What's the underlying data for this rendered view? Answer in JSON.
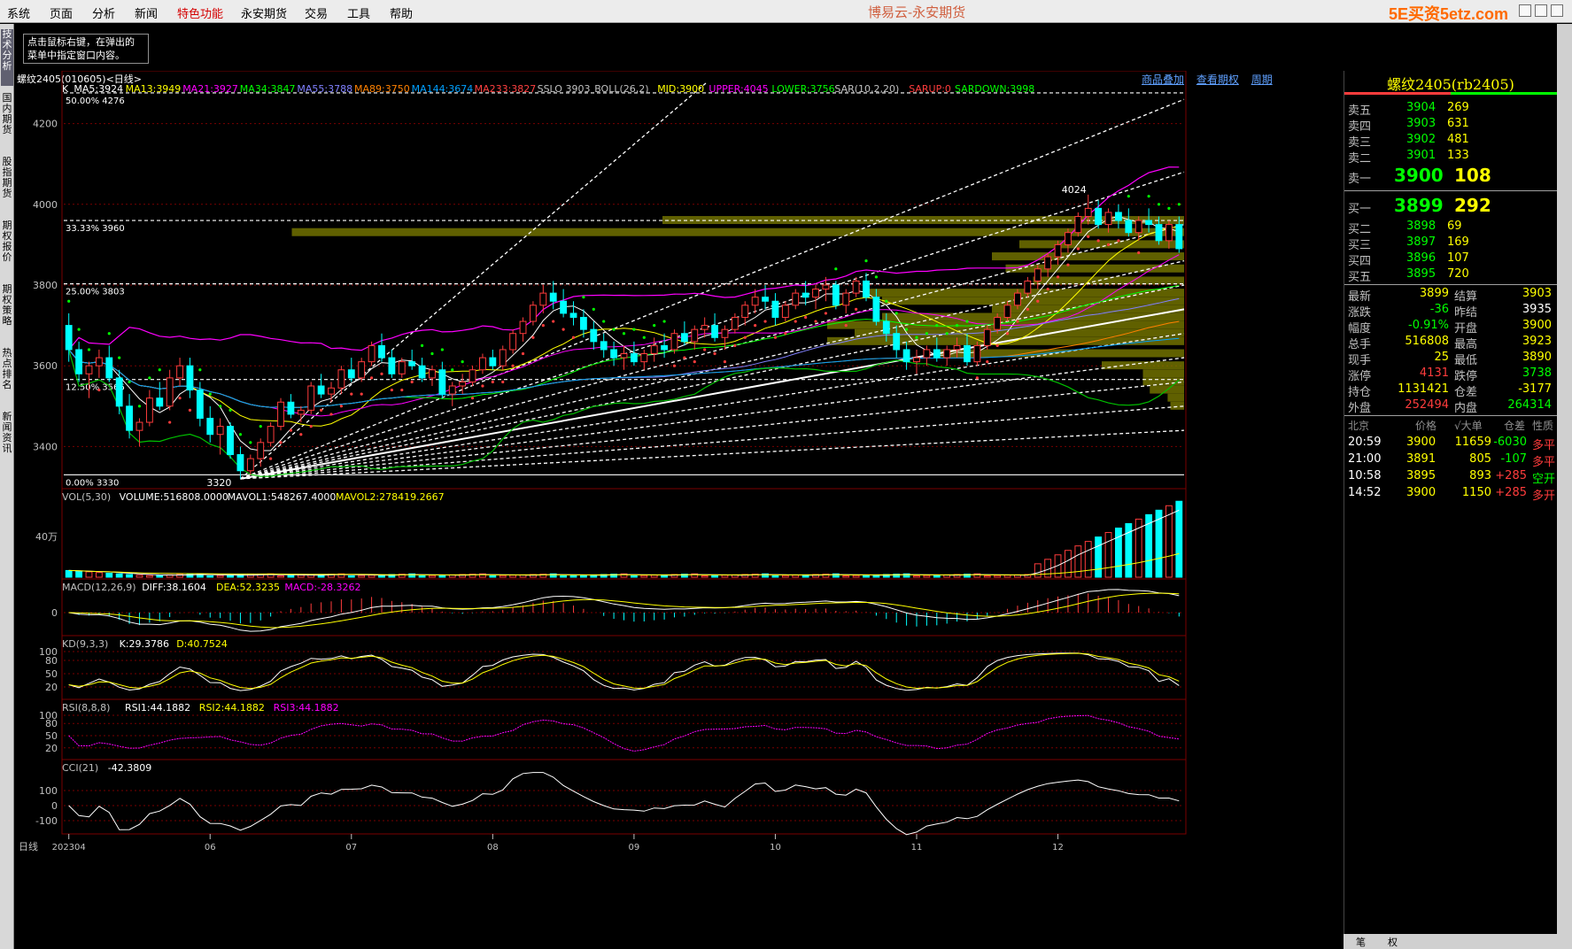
{
  "menu": {
    "items": [
      "系统",
      "页面",
      "分析",
      "新闻",
      "特色功能",
      "永安期货",
      "交易",
      "工具",
      "帮助"
    ],
    "highlight_index": 4,
    "app_title": "博易云-永安期货",
    "watermark": "5E买资5etz.com"
  },
  "hint_text": "点击鼠标右键，在弹出的\n菜单中指定窗口内容。",
  "left_tabs": [
    "技术分析",
    "国内期货",
    "股指期货",
    "期权报价",
    "期权策略",
    "热点排名",
    "新闻资讯"
  ],
  "chart_header": {
    "title": "螺纹2405(010605)<日线>",
    "links": [
      "商品叠加",
      "查看期权",
      "周期"
    ]
  },
  "colors": {
    "up": "#ff3c3c",
    "down": "#00ffff",
    "ma5": "#ffffff",
    "ma13": "#ffff00",
    "ma21": "#ff00ff",
    "ma34": "#00ff00",
    "ma55": "#8080ff",
    "ma89": "#ff8000",
    "ma144": "#00a0ff",
    "ma233": "#ff4040",
    "grid": "#7a0000",
    "fib": "#ffffff",
    "profile": "#808000"
  },
  "main_legend": [
    {
      "text": "K",
      "color": "#ffffff"
    },
    {
      "text": "MA5:3924",
      "color": "#ffffff"
    },
    {
      "text": "MA13:3949",
      "color": "#ffff00"
    },
    {
      "text": "MA21:3927",
      "color": "#ff00ff"
    },
    {
      "text": "MA34:3847",
      "color": "#00ff00"
    },
    {
      "text": "MA55:3788",
      "color": "#8080ff"
    },
    {
      "text": "MA89:3750",
      "color": "#ff8000"
    },
    {
      "text": "MA144:3674",
      "color": "#00a0ff"
    },
    {
      "text": "MA233:3827",
      "color": "#ff4040"
    },
    {
      "text": "SSLO 3903",
      "color": "#c0c0c0"
    },
    {
      "text": "BOLL(26,2)",
      "color": "#c0c0c0"
    },
    {
      "text": "MID:3900",
      "color": "#ffff00"
    },
    {
      "text": "UPPER:4045",
      "color": "#ff00ff"
    },
    {
      "text": "LOWER:3756",
      "color": "#00ff00"
    },
    {
      "text": "SAR(10,2,20)",
      "color": "#c0c0c0"
    },
    {
      "text": "SARUP:0",
      "color": "#ff3c3c"
    },
    {
      "text": "SARDOWN:3998",
      "color": "#00ff00"
    }
  ],
  "price_axis": {
    "ticks": [
      4200,
      4000,
      3800,
      3600,
      3400
    ],
    "min": 3300,
    "max": 4300
  },
  "fib_levels": [
    {
      "label": "50.00%  4276",
      "price": 4276
    },
    {
      "label": "33.33%  3960",
      "price": 3960
    },
    {
      "label": "25.00%  3803",
      "price": 3803
    },
    {
      "label": "12.50%  3566",
      "price": 3566
    },
    {
      "label": "0.00%  3330",
      "price": 3330
    }
  ],
  "annotations": {
    "high": "4024",
    "low": "3320"
  },
  "chart_data": {
    "type": "candlestick",
    "x_labels": [
      "202304",
      "06",
      "07",
      "08",
      "09",
      "10",
      "11",
      "12"
    ],
    "candles": [
      [
        3700,
        3730,
        3610,
        3640
      ],
      [
        3640,
        3660,
        3560,
        3580
      ],
      [
        3580,
        3610,
        3520,
        3600
      ],
      [
        3600,
        3640,
        3570,
        3620
      ],
      [
        3620,
        3650,
        3560,
        3570
      ],
      [
        3570,
        3590,
        3480,
        3500
      ],
      [
        3500,
        3530,
        3420,
        3440
      ],
      [
        3440,
        3470,
        3400,
        3460
      ],
      [
        3460,
        3540,
        3450,
        3520
      ],
      [
        3520,
        3560,
        3490,
        3500
      ],
      [
        3500,
        3590,
        3490,
        3570
      ],
      [
        3570,
        3620,
        3550,
        3600
      ],
      [
        3600,
        3620,
        3520,
        3540
      ],
      [
        3540,
        3560,
        3450,
        3470
      ],
      [
        3470,
        3500,
        3410,
        3430
      ],
      [
        3430,
        3470,
        3380,
        3450
      ],
      [
        3450,
        3460,
        3370,
        3380
      ],
      [
        3380,
        3400,
        3320,
        3340
      ],
      [
        3340,
        3380,
        3330,
        3370
      ],
      [
        3370,
        3420,
        3350,
        3410
      ],
      [
        3410,
        3460,
        3400,
        3450
      ],
      [
        3450,
        3520,
        3440,
        3510
      ],
      [
        3510,
        3530,
        3470,
        3480
      ],
      [
        3480,
        3500,
        3460,
        3490
      ],
      [
        3490,
        3560,
        3480,
        3550
      ],
      [
        3550,
        3580,
        3520,
        3530
      ],
      [
        3530,
        3560,
        3510,
        3545
      ],
      [
        3545,
        3600,
        3530,
        3590
      ],
      [
        3590,
        3620,
        3560,
        3570
      ],
      [
        3570,
        3620,
        3560,
        3610
      ],
      [
        3610,
        3660,
        3600,
        3650
      ],
      [
        3650,
        3680,
        3610,
        3620
      ],
      [
        3620,
        3640,
        3570,
        3580
      ],
      [
        3580,
        3620,
        3570,
        3610
      ],
      [
        3610,
        3640,
        3590,
        3600
      ],
      [
        3600,
        3620,
        3560,
        3570
      ],
      [
        3570,
        3600,
        3550,
        3590
      ],
      [
        3590,
        3610,
        3520,
        3530
      ],
      [
        3530,
        3560,
        3500,
        3550
      ],
      [
        3550,
        3580,
        3530,
        3560
      ],
      [
        3560,
        3600,
        3550,
        3590
      ],
      [
        3590,
        3630,
        3580,
        3620
      ],
      [
        3620,
        3640,
        3590,
        3600
      ],
      [
        3600,
        3650,
        3590,
        3640
      ],
      [
        3640,
        3690,
        3630,
        3680
      ],
      [
        3680,
        3720,
        3660,
        3710
      ],
      [
        3710,
        3760,
        3700,
        3750
      ],
      [
        3750,
        3800,
        3730,
        3780
      ],
      [
        3780,
        3810,
        3740,
        3760
      ],
      [
        3760,
        3790,
        3720,
        3730
      ],
      [
        3730,
        3760,
        3700,
        3720
      ],
      [
        3720,
        3740,
        3670,
        3690
      ],
      [
        3690,
        3710,
        3640,
        3660
      ],
      [
        3660,
        3680,
        3620,
        3640
      ],
      [
        3640,
        3660,
        3600,
        3620
      ],
      [
        3620,
        3650,
        3590,
        3630
      ],
      [
        3630,
        3660,
        3600,
        3610
      ],
      [
        3610,
        3640,
        3590,
        3630
      ],
      [
        3630,
        3670,
        3610,
        3650
      ],
      [
        3650,
        3680,
        3620,
        3640
      ],
      [
        3640,
        3690,
        3630,
        3680
      ],
      [
        3680,
        3710,
        3650,
        3660
      ],
      [
        3660,
        3700,
        3640,
        3690
      ],
      [
        3690,
        3720,
        3670,
        3700
      ],
      [
        3700,
        3730,
        3660,
        3670
      ],
      [
        3670,
        3700,
        3640,
        3690
      ],
      [
        3690,
        3730,
        3680,
        3720
      ],
      [
        3720,
        3760,
        3700,
        3750
      ],
      [
        3750,
        3790,
        3730,
        3770
      ],
      [
        3770,
        3800,
        3740,
        3760
      ],
      [
        3760,
        3780,
        3700,
        3720
      ],
      [
        3720,
        3760,
        3710,
        3750
      ],
      [
        3750,
        3790,
        3740,
        3780
      ],
      [
        3780,
        3810,
        3750,
        3770
      ],
      [
        3770,
        3800,
        3740,
        3790
      ],
      [
        3790,
        3820,
        3760,
        3800
      ],
      [
        3800,
        3810,
        3740,
        3750
      ],
      [
        3750,
        3790,
        3730,
        3780
      ],
      [
        3780,
        3820,
        3770,
        3810
      ],
      [
        3810,
        3830,
        3760,
        3770
      ],
      [
        3770,
        3790,
        3700,
        3710
      ],
      [
        3710,
        3730,
        3660,
        3680
      ],
      [
        3680,
        3700,
        3620,
        3640
      ],
      [
        3640,
        3660,
        3590,
        3610
      ],
      [
        3610,
        3640,
        3580,
        3620
      ],
      [
        3620,
        3650,
        3600,
        3640
      ],
      [
        3640,
        3670,
        3610,
        3620
      ],
      [
        3620,
        3650,
        3600,
        3640
      ],
      [
        3640,
        3670,
        3620,
        3650
      ],
      [
        3650,
        3680,
        3600,
        3610
      ],
      [
        3610,
        3660,
        3600,
        3650
      ],
      [
        3650,
        3700,
        3640,
        3690
      ],
      [
        3690,
        3730,
        3680,
        3720
      ],
      [
        3720,
        3760,
        3710,
        3750
      ],
      [
        3750,
        3790,
        3740,
        3780
      ],
      [
        3780,
        3820,
        3770,
        3810
      ],
      [
        3810,
        3850,
        3790,
        3840
      ],
      [
        3840,
        3880,
        3820,
        3870
      ],
      [
        3870,
        3910,
        3850,
        3900
      ],
      [
        3900,
        3940,
        3880,
        3930
      ],
      [
        3930,
        3980,
        3920,
        3970
      ],
      [
        3970,
        4024,
        3950,
        3990
      ],
      [
        3990,
        4010,
        3940,
        3950
      ],
      [
        3950,
        3990,
        3930,
        3980
      ],
      [
        3980,
        4000,
        3940,
        3960
      ],
      [
        3960,
        3990,
        3920,
        3930
      ],
      [
        3930,
        3970,
        3910,
        3960
      ],
      [
        3960,
        3990,
        3930,
        3950
      ],
      [
        3950,
        3970,
        3900,
        3910
      ],
      [
        3910,
        3960,
        3890,
        3950
      ],
      [
        3950,
        3970,
        3880,
        3890
      ]
    ]
  },
  "sub_panels": [
    {
      "id": "vol",
      "legend": [
        {
          "text": "VOL(5,30)",
          "color": "#c0c0c0"
        },
        {
          "text": "VOLUME:516808.0000",
          "color": "#ffffff"
        },
        {
          "text": "MAVOL1:548267.4000",
          "color": "#ffffff"
        },
        {
          "text": "MAVOL2:278419.2667",
          "color": "#ffff00"
        }
      ],
      "ticks": [
        "40万"
      ]
    },
    {
      "id": "macd",
      "legend": [
        {
          "text": "MACD(12,26,9)",
          "color": "#c0c0c0"
        },
        {
          "text": "DIFF:38.1604",
          "color": "#ffffff"
        },
        {
          "text": "DEA:52.3235",
          "color": "#ffff00"
        },
        {
          "text": "MACD:-28.3262",
          "color": "#ff00ff"
        }
      ],
      "ticks": [
        "0"
      ]
    },
    {
      "id": "kd",
      "legend": [
        {
          "text": "KD(9,3,3)",
          "color": "#c0c0c0"
        },
        {
          "text": "K:29.3786",
          "color": "#ffffff"
        },
        {
          "text": "D:40.7524",
          "color": "#ffff00"
        }
      ],
      "ticks": [
        "100",
        "80",
        "50",
        "20"
      ]
    },
    {
      "id": "rsi",
      "legend": [
        {
          "text": "RSI(8,8,8)",
          "color": "#c0c0c0"
        },
        {
          "text": "RSI1:44.1882",
          "color": "#ffffff"
        },
        {
          "text": "RSI2:44.1882",
          "color": "#ffff00"
        },
        {
          "text": "RSI3:44.1882",
          "color": "#ff00ff"
        }
      ],
      "ticks": [
        "100",
        "80",
        "50",
        "20"
      ]
    },
    {
      "id": "cci",
      "legend": [
        {
          "text": "CCI(21)",
          "color": "#c0c0c0"
        },
        {
          "text": "-42.3809",
          "color": "#ffffff"
        }
      ],
      "ticks": [
        "100",
        "0",
        "-100"
      ]
    }
  ],
  "quote": {
    "title": "螺纹2405(rb2405)",
    "asks": [
      {
        "label": "卖五",
        "price": "3904",
        "vol": "269"
      },
      {
        "label": "卖四",
        "price": "3903",
        "vol": "631"
      },
      {
        "label": "卖三",
        "price": "3902",
        "vol": "481"
      },
      {
        "label": "卖二",
        "price": "3901",
        "vol": "133"
      },
      {
        "label": "卖一",
        "price": "3900",
        "vol": "108"
      }
    ],
    "bids": [
      {
        "label": "买一",
        "price": "3899",
        "vol": "292"
      },
      {
        "label": "买二",
        "price": "3898",
        "vol": "69"
      },
      {
        "label": "买三",
        "price": "3897",
        "vol": "169"
      },
      {
        "label": "买四",
        "price": "3896",
        "vol": "107"
      },
      {
        "label": "买五",
        "price": "3895",
        "vol": "720"
      }
    ],
    "stats": [
      {
        "l1": "最新",
        "v1": "3899",
        "c1": "#ffff00",
        "l2": "结算",
        "v2": "3903",
        "c2": "#ffff00"
      },
      {
        "l1": "涨跌",
        "v1": "-36",
        "c1": "#00ff00",
        "l2": "昨结",
        "v2": "3935",
        "c2": "#ffffff"
      },
      {
        "l1": "幅度",
        "v1": "-0.91%",
        "c1": "#00ff00",
        "l2": "开盘",
        "v2": "3900",
        "c2": "#ffff00"
      },
      {
        "l1": "总手",
        "v1": "516808",
        "c1": "#ffff00",
        "l2": "最高",
        "v2": "3923",
        "c2": "#ffff00"
      },
      {
        "l1": "现手",
        "v1": "25",
        "c1": "#ffff00",
        "l2": "最低",
        "v2": "3890",
        "c2": "#ffff00"
      },
      {
        "l1": "涨停",
        "v1": "4131",
        "c1": "#ff3c3c",
        "l2": "跌停",
        "v2": "3738",
        "c2": "#00ff00"
      },
      {
        "l1": "持仓",
        "v1": "1131421",
        "c1": "#ffff00",
        "l2": "仓差",
        "v2": "-3177",
        "c2": "#ffff00"
      },
      {
        "l1": "外盘",
        "v1": "252494",
        "c1": "#ff3c3c",
        "l2": "内盘",
        "v2": "264314",
        "c2": "#00ff00"
      }
    ],
    "tick_header": [
      "北京",
      "价格",
      "√大单",
      "仓差",
      "性质"
    ],
    "ticks": [
      {
        "time": "20:59",
        "price": "3900",
        "vol": "11659",
        "oi": "-6030",
        "type": "多平",
        "tc": "#ff3c3c",
        "oc": "#00ff00"
      },
      {
        "time": "21:00",
        "price": "3891",
        "vol": "805",
        "oi": "-107",
        "type": "多平",
        "tc": "#ff3c3c",
        "oc": "#00ff00"
      },
      {
        "time": "10:58",
        "price": "3895",
        "vol": "893",
        "oi": "+285",
        "type": "空开",
        "tc": "#00ff00",
        "oc": "#ff3c3c"
      },
      {
        "time": "14:52",
        "price": "3900",
        "vol": "1150",
        "oi": "+285",
        "type": "多开",
        "tc": "#ff3c3c",
        "oc": "#ff3c3c"
      }
    ],
    "bottom_tabs": [
      "笔",
      "权"
    ]
  }
}
